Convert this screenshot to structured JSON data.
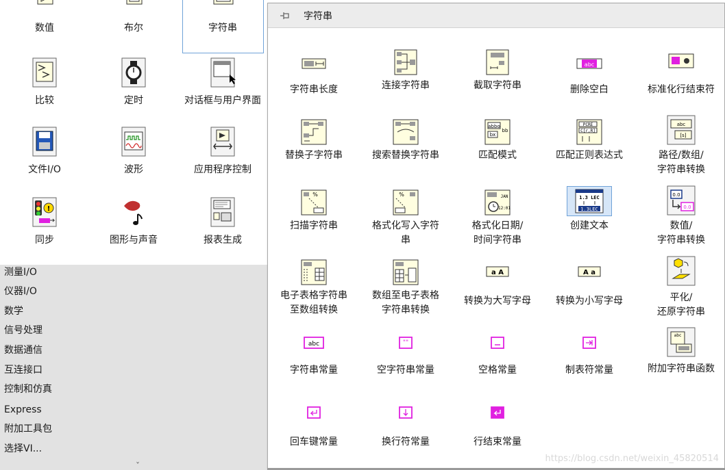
{
  "palette": {
    "items": [
      {
        "label": "数值"
      },
      {
        "label": "布尔"
      },
      {
        "label": "字符串"
      },
      {
        "label": "比较"
      },
      {
        "label": "定时"
      },
      {
        "label": "对话框与用户界面"
      },
      {
        "label": "文件I/O"
      },
      {
        "label": "波形"
      },
      {
        "label": "应用程序控制"
      },
      {
        "label": "同步"
      },
      {
        "label": "图形与声音"
      },
      {
        "label": "报表生成"
      }
    ],
    "categories": [
      "测量I/O",
      "仪器I/O",
      "数学",
      "信号处理",
      "数据通信",
      "互连接口",
      "控制和仿真",
      "Express",
      "附加工具包",
      "选择VI..."
    ]
  },
  "popup": {
    "title": "字符串",
    "functions": [
      [
        "字符串长度"
      ],
      [
        "连接字符串"
      ],
      [
        "截取字符串"
      ],
      [
        "删除空白"
      ],
      [
        "标准化行结束符"
      ],
      [
        "替换子字符串"
      ],
      [
        "搜索替换字符串"
      ],
      [
        "匹配模式"
      ],
      [
        "匹配正则表达式"
      ],
      [
        "路径/数组/",
        "字符串转换"
      ],
      [
        "扫描字符串"
      ],
      [
        "格式化写入字符",
        "串"
      ],
      [
        "格式化日期/",
        "时间字符串"
      ],
      [
        "创建文本"
      ],
      [
        "数值/",
        "字符串转换"
      ],
      [
        "电子表格字符串",
        "至数组转换"
      ],
      [
        "数组至电子表格",
        "字符串转换"
      ],
      [
        "转换为大写字母"
      ],
      [
        "转换为小写字母"
      ],
      [
        "平化/",
        "还原字符串"
      ],
      [
        "字符串常量"
      ],
      [
        "空字符串常量"
      ],
      [
        "空格常量"
      ],
      [
        "制表符常量"
      ],
      [
        "附加字符串函数"
      ],
      [
        "回车键常量"
      ],
      [
        "换行符常量"
      ],
      [
        "行结束常量"
      ]
    ],
    "icon_glyphs": {
      "upper": "a A",
      "lower": "A a",
      "const": "abc",
      "empty": "\"\""
    }
  },
  "watermark": "https://blog.csdn.net/weixin_45820514",
  "accent_color": "#e020e0"
}
